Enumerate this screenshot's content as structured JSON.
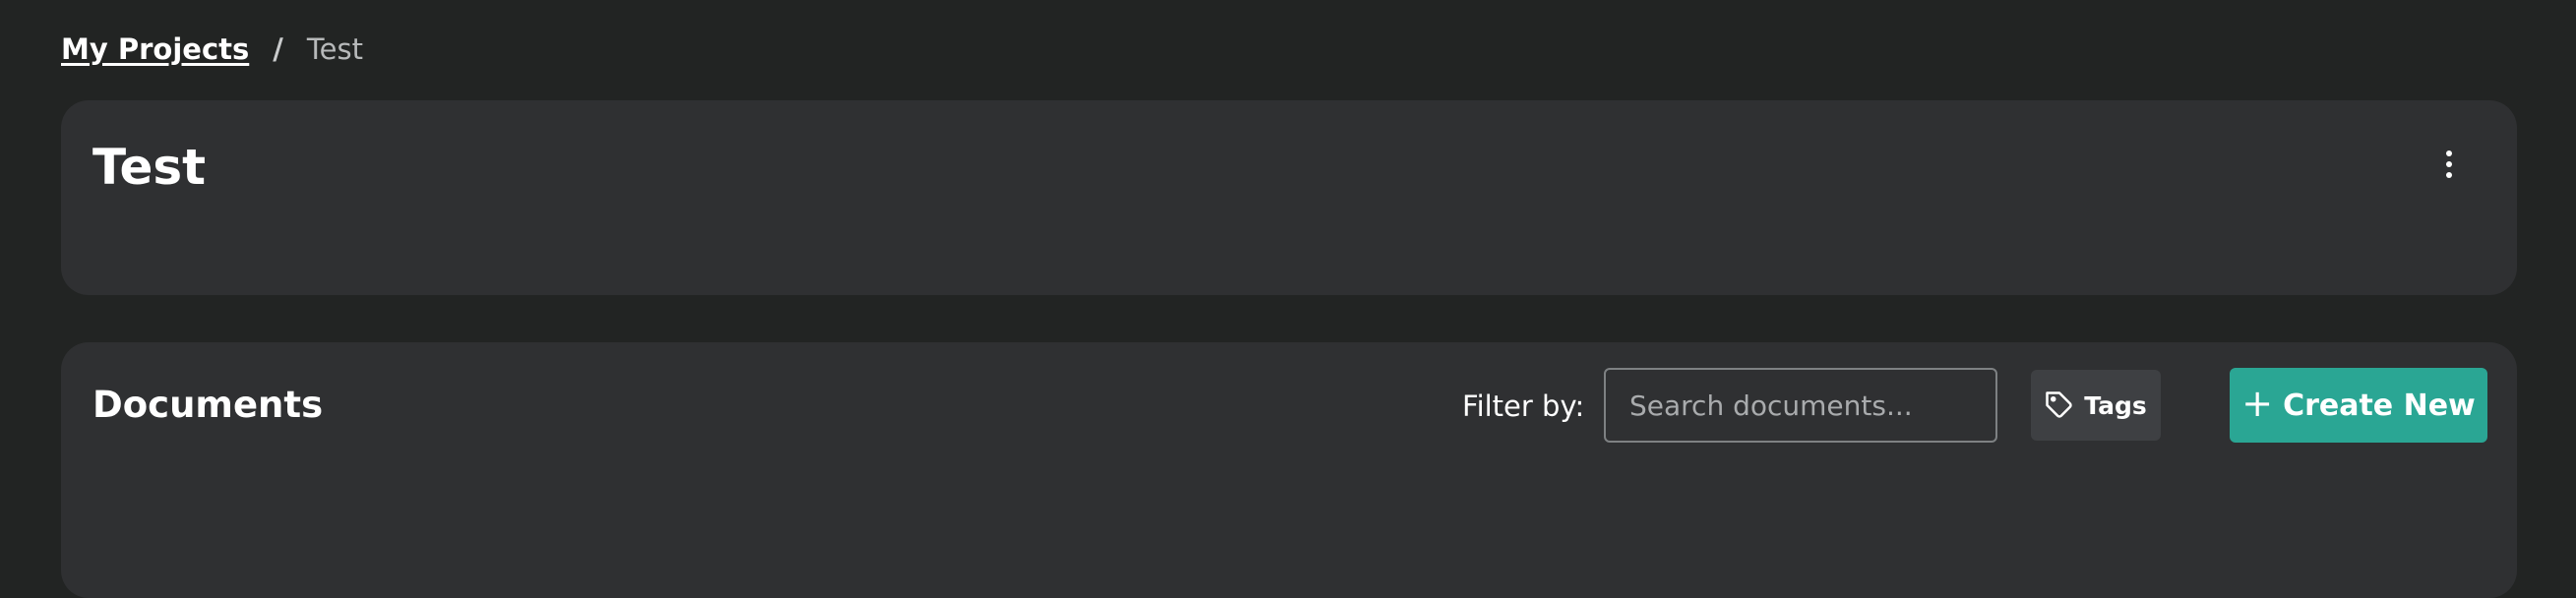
{
  "breadcrumb": {
    "items": [
      {
        "label": "My Projects"
      },
      {
        "label": "Test"
      }
    ],
    "separator": "/"
  },
  "project": {
    "title": "Test",
    "menu_icon": "more-vertical-icon"
  },
  "documents": {
    "title": "Documents",
    "filter_label": "Filter by:",
    "search_placeholder": "Search documents...",
    "search_value": "",
    "tags_label": "Tags",
    "tags_icon": "tag-icon",
    "create_icon": "plus-icon",
    "create_label": "Create New"
  },
  "colors": {
    "page_background": "#222423",
    "card_background": "#2f3032",
    "accent": "#2aa694",
    "secondary_button": "#3e4043"
  }
}
